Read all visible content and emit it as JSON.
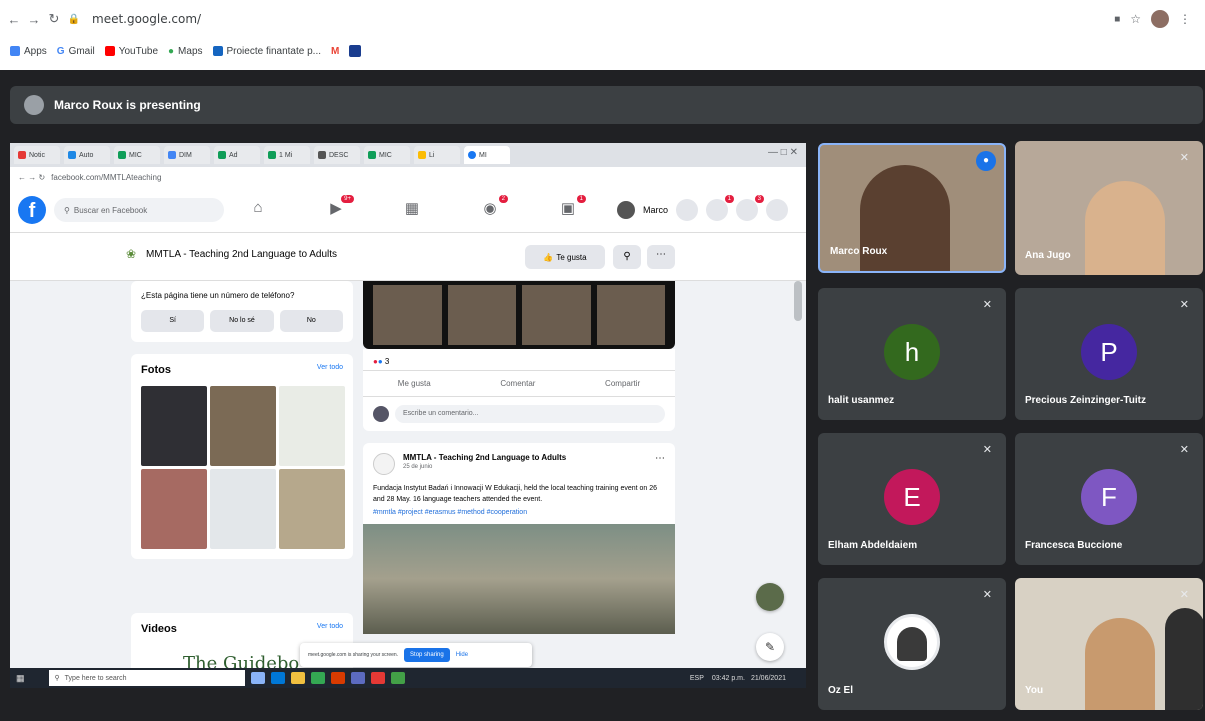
{
  "browser": {
    "url": "meet.google.com/",
    "bookmarks": [
      "Apps",
      "Gmail",
      "YouTube",
      "Maps",
      "Proiecte finantate p...",
      "",
      ""
    ]
  },
  "meet": {
    "presenting_text": "Marco Roux is presenting",
    "participants": [
      {
        "name": "Marco Roux",
        "type": "video",
        "active": true
      },
      {
        "name": "Ana Jugo",
        "type": "video"
      },
      {
        "name": "halit usanmez",
        "initial": "h",
        "color": "#33691e"
      },
      {
        "name": "Precious Zeinzinger-Tuitz",
        "initial": "P",
        "color": "#4527a0"
      },
      {
        "name": "Elham Abdeldaiem",
        "initial": "E",
        "color": "#c2185b"
      },
      {
        "name": "Francesca Buccione",
        "initial": "F",
        "color": "#7e57c2"
      },
      {
        "name": "Oz El",
        "type": "avatar"
      },
      {
        "name": "You",
        "type": "video"
      }
    ]
  },
  "facebook": {
    "url": "facebook.com/MMTLAteaching",
    "search_placeholder": "Buscar en Facebook",
    "user_name": "Marco",
    "page_name": "MMTLA - Teaching 2nd Language to Adults",
    "like_button": "Te gusta",
    "question": "¿Esta página tiene un número de teléfono?",
    "answers": [
      "Sí",
      "No lo sé",
      "No"
    ],
    "photos_title": "Fotos",
    "see_all": "Ver todo",
    "videos_title": "Videos",
    "guidebook_text": "The Guidebo",
    "reactions_count": "3",
    "actions": [
      "Me gusta",
      "Comentar",
      "Compartir"
    ],
    "comment_placeholder": "Escribe un comentario...",
    "post": {
      "author": "MMTLA - Teaching 2nd Language to Adults",
      "date": "25 de junio",
      "body": "Fundacja Instytut Badań i Innowacji W Edukacji, held the local teaching training event on 26 and 28 May. 16 language teachers attended the event.",
      "tags": "#mmtla #project #erasmus #method #cooperation"
    },
    "share_notice": "meet.google.com is sharing your screen.",
    "stop_sharing": "Stop sharing",
    "hide": "Hide"
  },
  "taskbar": {
    "search_placeholder": "Type here to search",
    "time": "03:42 p.m.",
    "date": "21/06/2021",
    "lang": "ESP"
  }
}
